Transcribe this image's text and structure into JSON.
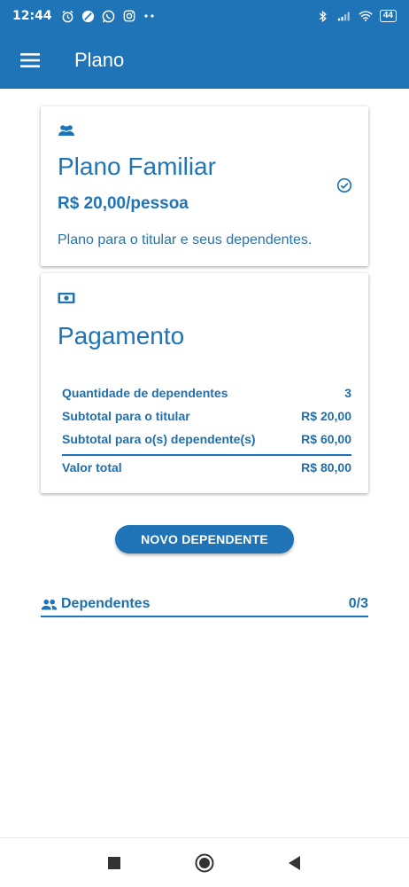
{
  "status_bar": {
    "time": "12:44",
    "battery": "44"
  },
  "app_bar": {
    "title": "Plano"
  },
  "plan_card": {
    "icon": "group-icon",
    "title": "Plano Familiar",
    "price": "R$ 20,00/pessoa",
    "description": "Plano para o titular e seus dependentes.",
    "selected_icon": "check-circle-icon"
  },
  "payment_card": {
    "icon": "money-icon",
    "title": "Pagamento",
    "rows": [
      {
        "label": "Quantidade de dependentes",
        "value": "3"
      },
      {
        "label": "Subtotal para o titular",
        "value": "R$ 20,00"
      },
      {
        "label": "Subtotal para o(s) dependente(s)",
        "value": "R$ 60,00"
      }
    ],
    "total": {
      "label": "Valor total",
      "value": "R$ 80,00"
    }
  },
  "new_dependent_button": "NOVO DEPENDENTE",
  "dependents": {
    "label": "Dependentes",
    "count": "0/3"
  },
  "colors": {
    "primary": "#1f73b7",
    "background": "#ffffff"
  }
}
